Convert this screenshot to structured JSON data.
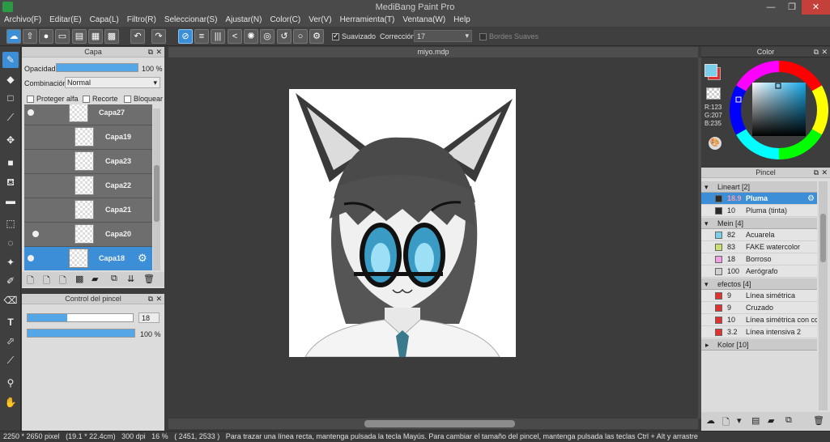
{
  "window": {
    "title": "MediBang Paint Pro"
  },
  "menu": [
    "Archivo(F)",
    "Editar(E)",
    "Capa(L)",
    "Filtro(R)",
    "Seleccionar(S)",
    "Ajustar(N)",
    "Color(C)",
    "Ver(V)",
    "Herramienta(T)",
    "Ventana(W)",
    "Help"
  ],
  "toolbar": {
    "smooth_label": "Suavizado",
    "correction_label": "Corrección",
    "correction_value": "17",
    "soft_edges_label": "Bordes Suaves"
  },
  "layer_panel": {
    "title": "Capa",
    "opacity_label": "Opacidad",
    "opacity_value": "100 %",
    "opacity_fraction": 1.0,
    "blend_label": "Combinación",
    "blend_value": "Normal",
    "protect_alpha": "Proteger alfa",
    "clip": "Recorte",
    "lock": "Bloquear",
    "layers": [
      {
        "name": "Capa27",
        "visible": true,
        "selected": false
      },
      {
        "name": "Capa19",
        "visible": false,
        "selected": false
      },
      {
        "name": "Capa23",
        "visible": false,
        "selected": false
      },
      {
        "name": "Capa22",
        "visible": false,
        "selected": false
      },
      {
        "name": "Capa21",
        "visible": false,
        "selected": false
      },
      {
        "name": "Capa20",
        "visible": true,
        "selected": false
      },
      {
        "name": "Capa18",
        "visible": true,
        "selected": true
      }
    ]
  },
  "brush_control": {
    "title": "Control del pincel",
    "size_value": "18",
    "opacity_value": "100 %",
    "size_fraction": 0.38,
    "opacity_fraction": 1.0
  },
  "document": {
    "tab": "miyo.mdp"
  },
  "color_panel": {
    "title": "Color",
    "r": "R:123",
    "g": "G:207",
    "b": "B:235",
    "fg_color": "#7bcfeb",
    "bg_color": "#e03030"
  },
  "brush_panel": {
    "title": "Pincel",
    "groups": [
      {
        "name": "Lineart [2]",
        "items": [
          {
            "size": "18.9",
            "name": "Pluma",
            "color": "#2a2a2a",
            "selected": true
          },
          {
            "size": "10",
            "name": "Pluma (tinta)",
            "color": "#2a2a2a",
            "selected": false
          }
        ]
      },
      {
        "name": "Mein [4]",
        "items": [
          {
            "size": "82",
            "name": "Acuarela",
            "color": "#7bcfeb"
          },
          {
            "size": "83",
            "name": "FAKE watercolor",
            "color": "#c8e070"
          },
          {
            "size": "18",
            "name": "Borroso",
            "color": "#f0a0e0"
          },
          {
            "size": "100",
            "name": "Aerógrafo",
            "color": "#d0d0d0"
          }
        ]
      },
      {
        "name": "efectos [4]",
        "items": [
          {
            "size": "9",
            "name": "Línea simétrica",
            "color": "#e03030"
          },
          {
            "size": "9",
            "name": "Cruzado",
            "color": "#e03030"
          },
          {
            "size": "10",
            "name": "Línea simétrica con cc",
            "color": "#e03030"
          },
          {
            "size": "3.2",
            "name": "Línea intensiva 2",
            "color": "#e03030"
          }
        ]
      },
      {
        "name": "Kolor [10]",
        "items": []
      }
    ]
  },
  "status": {
    "dimensions": "2250 * 2650 pixel",
    "physical": "(19.1 * 22.4cm)",
    "dpi": "300 dpi",
    "zoom": "16 %",
    "coords": "( 2451, 2533 )",
    "hint": "Para trazar una línea recta, mantenga pulsada la tecla Mayús. Para cambiar el tamaño del pincel, mantenga pulsada las teclas Ctrl + Alt y arrastre"
  }
}
